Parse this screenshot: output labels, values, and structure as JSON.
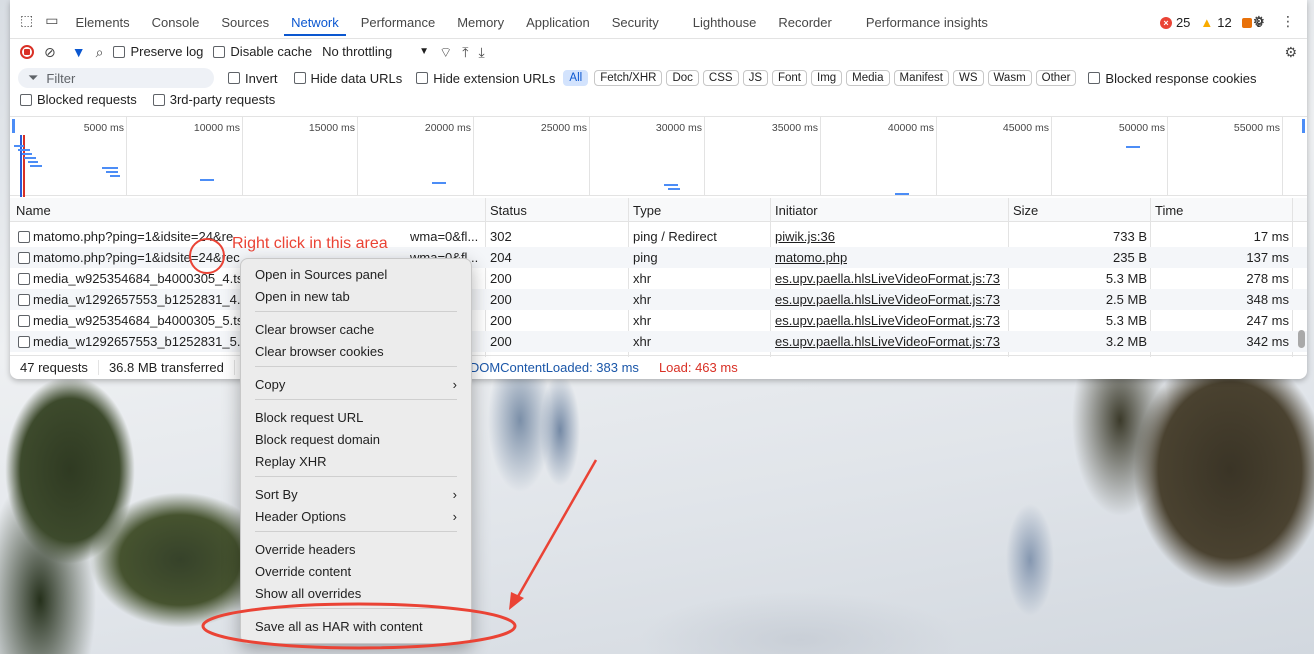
{
  "tabs": [
    "Elements",
    "Console",
    "Sources",
    "Network",
    "Performance",
    "Memory",
    "Application",
    "Security",
    "Lighthouse",
    "Recorder",
    "Performance insights"
  ],
  "counters": {
    "errors": "25",
    "warnings": "12",
    "issues": "9"
  },
  "toolbar": {
    "preserve_log": "Preserve log",
    "disable_cache": "Disable cache",
    "throttling": "No throttling"
  },
  "filter": {
    "placeholder": "Filter",
    "invert": "Invert",
    "hide_data": "Hide data URLs",
    "hide_ext": "Hide extension URLs",
    "blocked_cookies": "Blocked response cookies",
    "types": [
      "All",
      "Fetch/XHR",
      "Doc",
      "CSS",
      "JS",
      "Font",
      "Img",
      "Media",
      "Manifest",
      "WS",
      "Wasm",
      "Other"
    ]
  },
  "row2": {
    "blocked": "Blocked requests",
    "third_party": "3rd-party requests"
  },
  "overview": {
    "ticks": [
      "5000 ms",
      "10000 ms",
      "15000 ms",
      "20000 ms",
      "25000 ms",
      "30000 ms",
      "35000 ms",
      "40000 ms",
      "45000 ms",
      "50000 ms",
      "55000 ms"
    ]
  },
  "columns": {
    "name": "Name",
    "status": "Status",
    "type": "Type",
    "initiator": "Initiator",
    "size": "Size",
    "time": "Time"
  },
  "rows": [
    {
      "name": "matomo.php?ping=1&idsite=24&re",
      "name_tail": "wma=0&fl...",
      "status": "302",
      "type": "ping / Redirect",
      "initiator": "piwik.js:36",
      "size": "733 B",
      "time": "17 ms"
    },
    {
      "name": "matomo.php?ping=1&idsite=24&rec",
      "name_tail": "wma=0&fl...",
      "status": "204",
      "type": "ping",
      "initiator": "matomo.php",
      "size": "235 B",
      "time": "137 ms"
    },
    {
      "name": "media_w925354684_b4000305_4.ts",
      "name_tail": "",
      "status": "200",
      "type": "xhr",
      "initiator": "es.upv.paella.hlsLiveVideoFormat.js:73",
      "size": "5.3 MB",
      "time": "278 ms"
    },
    {
      "name": "media_w1292657553_b1252831_4.ts",
      "name_tail": "",
      "status": "200",
      "type": "xhr",
      "initiator": "es.upv.paella.hlsLiveVideoFormat.js:73",
      "size": "2.5 MB",
      "time": "348 ms"
    },
    {
      "name": "media_w925354684_b4000305_5.ts",
      "name_tail": "",
      "status": "200",
      "type": "xhr",
      "initiator": "es.upv.paella.hlsLiveVideoFormat.js:73",
      "size": "5.3 MB",
      "time": "247 ms"
    },
    {
      "name": "media_w1292657553_b1252831_5.ts",
      "name_tail": "",
      "status": "200",
      "type": "xhr",
      "initiator": "es.upv.paella.hlsLiveVideoFormat.js:73",
      "size": "3.2 MB",
      "time": "342 ms"
    }
  ],
  "statusbar": {
    "requests": "47 requests",
    "transferred": "36.8 MB transferred",
    "dcl": "DOMContentLoaded: 383 ms",
    "load": "Load: 463 ms"
  },
  "menu": {
    "open_sources": "Open in Sources panel",
    "open_tab": "Open in new tab",
    "clear_cache": "Clear browser cache",
    "clear_cookies": "Clear browser cookies",
    "copy": "Copy",
    "block_url": "Block request URL",
    "block_domain": "Block request domain",
    "replay": "Replay XHR",
    "sort_by": "Sort By",
    "header_options": "Header Options",
    "override_headers": "Override headers",
    "override_content": "Override content",
    "show_overrides": "Show all overrides",
    "save_har": "Save all as HAR with content"
  },
  "annotation": "Right click in this area",
  "colors": {
    "accent": "#0b57d0",
    "error": "#ea4335",
    "warning": "#f9ab00",
    "annotation": "#ea4335"
  }
}
